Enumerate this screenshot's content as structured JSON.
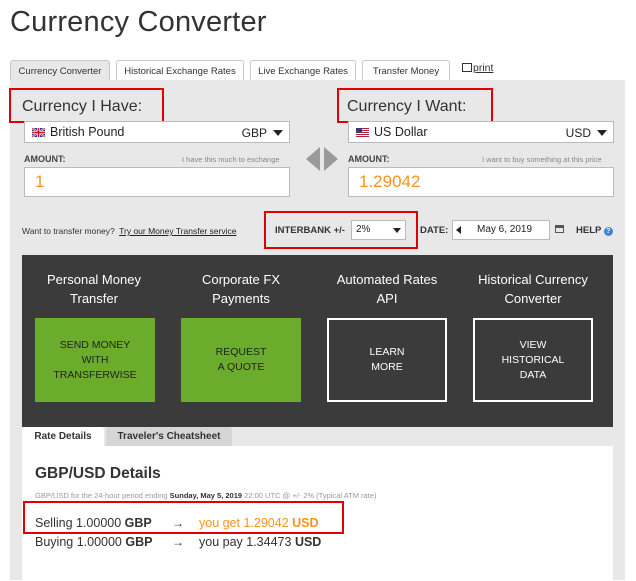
{
  "page_title": "Currency Converter",
  "tabs": [
    {
      "label": "Currency Converter",
      "active": true
    },
    {
      "label": "Historical Exchange Rates",
      "active": false
    },
    {
      "label": "Live Exchange Rates",
      "active": false
    },
    {
      "label": "Transfer Money",
      "active": false
    }
  ],
  "print_label": "print",
  "have": {
    "section_label": "Currency I Have:",
    "currency_name": "British Pound",
    "currency_code": "GBP",
    "amount_label": "AMOUNT:",
    "amount_hint": "I have this much to exchange",
    "amount_value": "1"
  },
  "want": {
    "section_label": "Currency I Want:",
    "currency_name": "US Dollar",
    "currency_code": "USD",
    "amount_label": "AMOUNT:",
    "amount_hint": "I want to buy something at this price",
    "amount_value": "1.29042"
  },
  "transfer_prompt": "Want to transfer money?",
  "transfer_link": "Try our Money Transfer service",
  "interbank": {
    "label": "INTERBANK +/-",
    "value": "2%"
  },
  "date": {
    "label": "DATE:",
    "value": "May 6, 2019"
  },
  "help_label": "HELP",
  "cards": [
    {
      "title_line1": "Personal Money",
      "title_line2": "Transfer",
      "button_lines": [
        "SEND MONEY",
        "WITH",
        "TRANSFERWISE"
      ]
    },
    {
      "title_line1": "Corporate FX",
      "title_line2": "Payments",
      "button_lines": [
        "REQUEST",
        "A QUOTE"
      ]
    },
    {
      "title_line1": "Automated Rates",
      "title_line2": "API",
      "button_lines": [
        "LEARN",
        "MORE"
      ]
    },
    {
      "title_line1": "Historical Currency",
      "title_line2": "Converter",
      "button_lines": [
        "VIEW",
        "HISTORICAL",
        "DATA"
      ]
    }
  ],
  "bottom_tabs": [
    {
      "label": "Rate Details",
      "active": true
    },
    {
      "label": "Traveler's Cheatsheet",
      "active": false
    }
  ],
  "details": {
    "heading": "GBP/USD Details",
    "note_prefix": "GBP/USD for the 24-hour period ending",
    "note_date": "Sunday, May 5, 2019",
    "note_suffix": "22:00 UTC @ +/- 2% (Typical ATM rate)",
    "selling": {
      "label": "Selling 1.00000",
      "code": "GBP",
      "arrow": "→",
      "result_text": "you get 1.29042",
      "result_code": "USD"
    },
    "buying": {
      "label": "Buying 1.00000",
      "code": "GBP",
      "arrow": "→",
      "result_text": "you pay 1.34473",
      "result_code": "USD"
    }
  },
  "colors": {
    "accent_orange": "#f7941d",
    "highlight_red": "#e00000",
    "button_green": "#6cac2c",
    "dark_panel": "#3b3b3b"
  }
}
